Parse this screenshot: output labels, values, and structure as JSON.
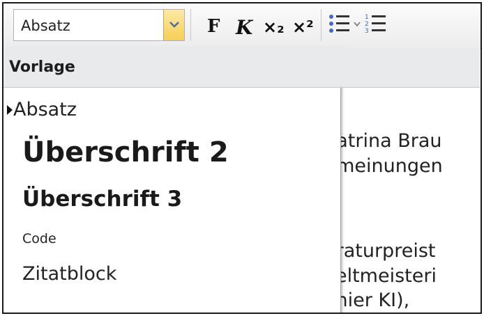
{
  "toolbar": {
    "style_select_value": "Absatz",
    "bold_label": "F",
    "italic_label": "K",
    "subscript_label": "×₂",
    "superscript_label": "×²"
  },
  "dropdown": {
    "header": "Vorlage",
    "items": [
      {
        "label": "Absatz",
        "selected": true
      },
      {
        "label": "Überschrift 2",
        "selected": false
      },
      {
        "label": "Überschrift 3",
        "selected": false
      },
      {
        "label": "Code",
        "selected": false
      },
      {
        "label": "Zitatblock",
        "selected": false
      }
    ]
  },
  "document": {
    "lines": [
      "Katrina Brau",
      "nmeinungen",
      "eraturpreist",
      "veltmeisteri",
      "onier KI),"
    ]
  }
}
